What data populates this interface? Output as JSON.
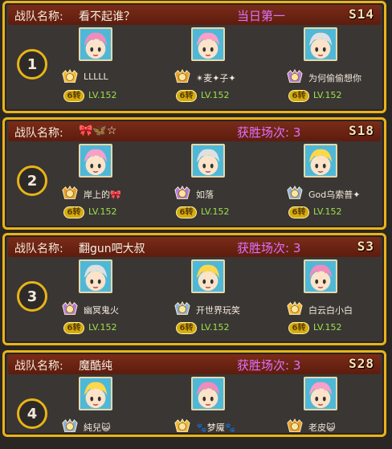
{
  "teams": [
    {
      "label": "战队名称:",
      "name": "看不起谁？",
      "result": "当日第一",
      "season": "S14",
      "rank": "1",
      "members": [
        {
          "badge_level": "12",
          "name": "LLLLL",
          "tier": "6转",
          "level": "LV.152",
          "avatar_icon": "pink-hair-character-icon",
          "avatar_color": "#f2a7a7"
        },
        {
          "badge_level": "30",
          "name": "✴麦✦子✦",
          "tier": "6转",
          "level": "LV.152",
          "avatar_icon": "pink-hair-character-icon",
          "avatar_color": "#f6c0c0"
        },
        {
          "badge_level": "30",
          "name": "为何偷偷想你",
          "tier": "6转",
          "level": "LV.152",
          "avatar_icon": "green-hat-character-icon",
          "avatar_color": "#a8e0a0"
        }
      ]
    },
    {
      "label": "战队名称:",
      "name": "🎀🦋☆",
      "result": "获胜场次: 3",
      "season": "S18",
      "rank": "2",
      "members": [
        {
          "badge_level": "3",
          "name": "岸上的🎀",
          "tier": "6转",
          "level": "LV.152",
          "avatar_icon": "white-hair-character-icon",
          "avatar_color": "#c8e6f0"
        },
        {
          "badge_level": "10",
          "name": "如落",
          "tier": "6转",
          "level": "LV.152",
          "avatar_icon": "pink-hair-character-icon",
          "avatar_color": "#f4b8b8"
        },
        {
          "badge_level": "15",
          "name": "God乌索普✦",
          "tier": "6转",
          "level": "LV.152",
          "avatar_icon": "blonde-character-icon",
          "avatar_color": "#f4e08a"
        }
      ]
    },
    {
      "label": "战队名称:",
      "name": "翻gun吧大叔",
      "result": "获胜场次: 3",
      "season": "S3",
      "rank": "3",
      "members": [
        {
          "badge_level": "10",
          "name": "幽冥鬼火",
          "tier": "6转",
          "level": "LV.152",
          "avatar_icon": "pink-hair-character-icon",
          "avatar_color": "#f2b0b0"
        },
        {
          "badge_level": "10",
          "name": "开世界玩笑",
          "tier": "6转",
          "level": "LV.152",
          "avatar_icon": "white-hair-character-icon",
          "avatar_color": "#c0e4e0"
        },
        {
          "badge_level": "10",
          "name": "白云白小白",
          "tier": "6转",
          "level": "LV.152",
          "avatar_icon": "pink-hair-character-icon",
          "avatar_color": "#f6c4c4"
        }
      ]
    },
    {
      "label": "战队名称:",
      "name": "魔酷纯",
      "result": "获胜场次: 3",
      "season": "S28",
      "rank": "4",
      "members": [
        {
          "badge_level": "5",
          "name": "純兒😺",
          "tier": "",
          "level": "",
          "avatar_icon": "white-hair-character-icon",
          "avatar_color": "#c8e6f0"
        },
        {
          "badge_level": "10",
          "name": "🐾梦魇🐾",
          "tier": "",
          "level": "",
          "avatar_icon": "pink-hair-character-icon",
          "avatar_color": "#f4b8b8"
        },
        {
          "badge_level": "8",
          "name": "老皮😺",
          "tier": "",
          "level": "",
          "avatar_icon": "white-hair-character-icon",
          "avatar_color": "#c8e6f0"
        }
      ]
    }
  ],
  "colors": {
    "frame": "#e8b418",
    "header": "#6a2414",
    "result_first": "#e060e0",
    "result_wins": "#e070ff",
    "level_text": "#9de24c",
    "tier_pill": "#d4ac10"
  }
}
